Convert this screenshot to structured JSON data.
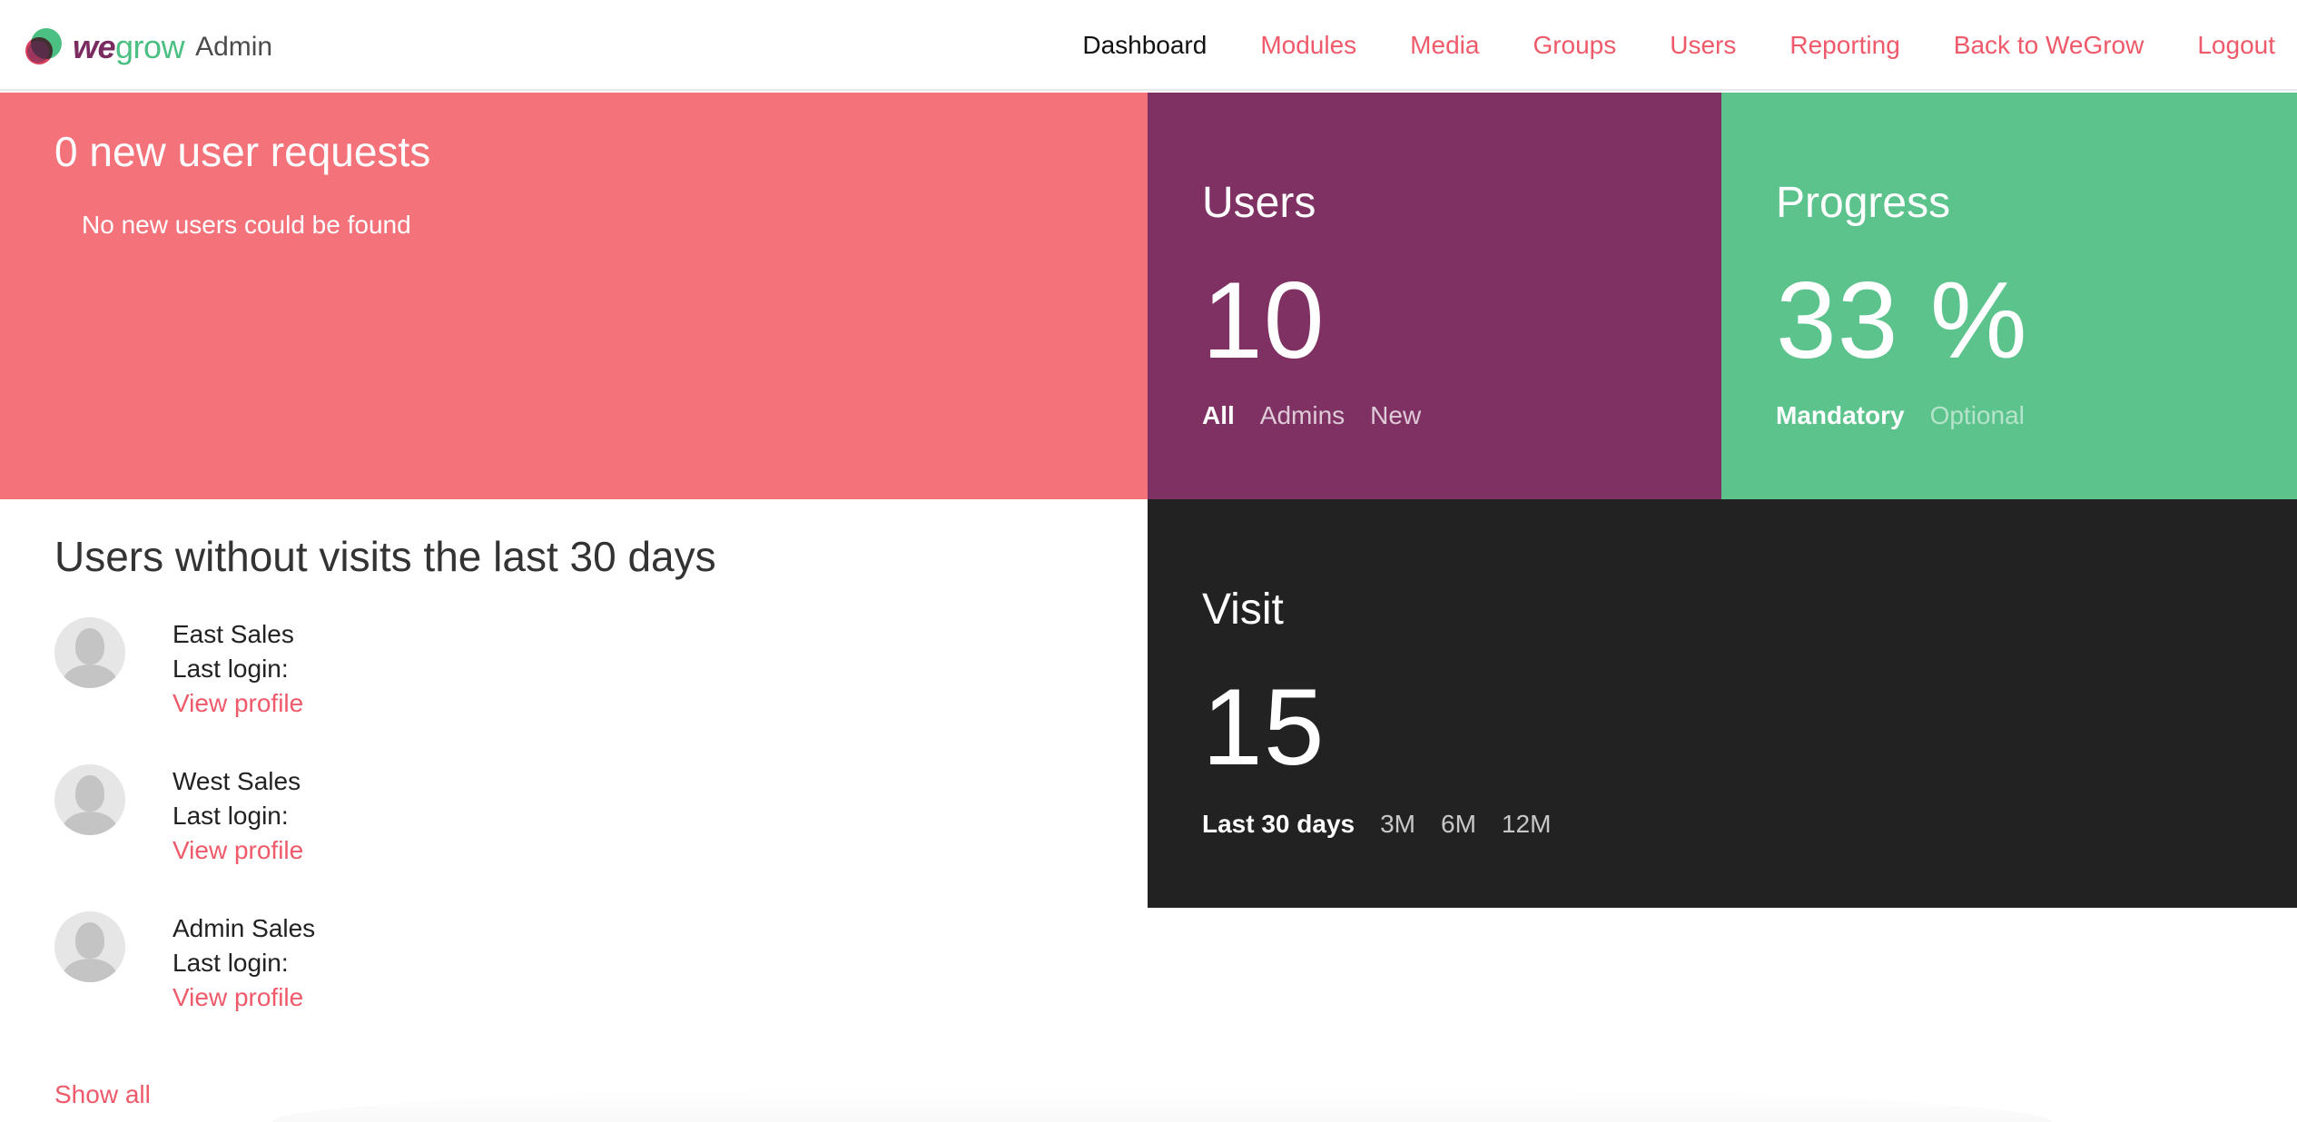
{
  "app": {
    "logo_we": "we",
    "logo_grow": "grow",
    "admin_label": "Admin"
  },
  "nav": {
    "items": [
      {
        "label": "Dashboard",
        "active": true
      },
      {
        "label": "Modules"
      },
      {
        "label": "Media"
      },
      {
        "label": "Groups"
      },
      {
        "label": "Users"
      },
      {
        "label": "Reporting"
      },
      {
        "label": "Back to WeGrow"
      },
      {
        "label": "Logout"
      }
    ]
  },
  "requests": {
    "title": "0 new user requests",
    "empty_message": "No new users could be found"
  },
  "users_stat": {
    "title": "Users",
    "value": "10",
    "filters": [
      "All",
      "Admins",
      "New"
    ],
    "active_filter": "All"
  },
  "progress_stat": {
    "title": "Progress",
    "value": "33 %",
    "filters": [
      "Mandatory",
      "Optional"
    ],
    "active_filter": "Mandatory"
  },
  "visit_stat": {
    "title": "Visit",
    "value": "15",
    "filters": [
      "Last 30 days",
      "3M",
      "6M",
      "12M"
    ],
    "active_filter": "Last 30 days"
  },
  "inactive": {
    "title": "Users without visits the last 30 days",
    "last_login_label": "Last login:",
    "view_profile_label": "View profile",
    "users": [
      {
        "name": "East Sales"
      },
      {
        "name": "West Sales"
      },
      {
        "name": "Admin Sales"
      }
    ],
    "show_all_label": "Show all"
  },
  "colors": {
    "accent": "#ef5a6a",
    "requests_bg": "#f4737b",
    "users_bg": "#7f3163",
    "progress_bg": "#5cc38c",
    "visit_bg": "#222222"
  }
}
